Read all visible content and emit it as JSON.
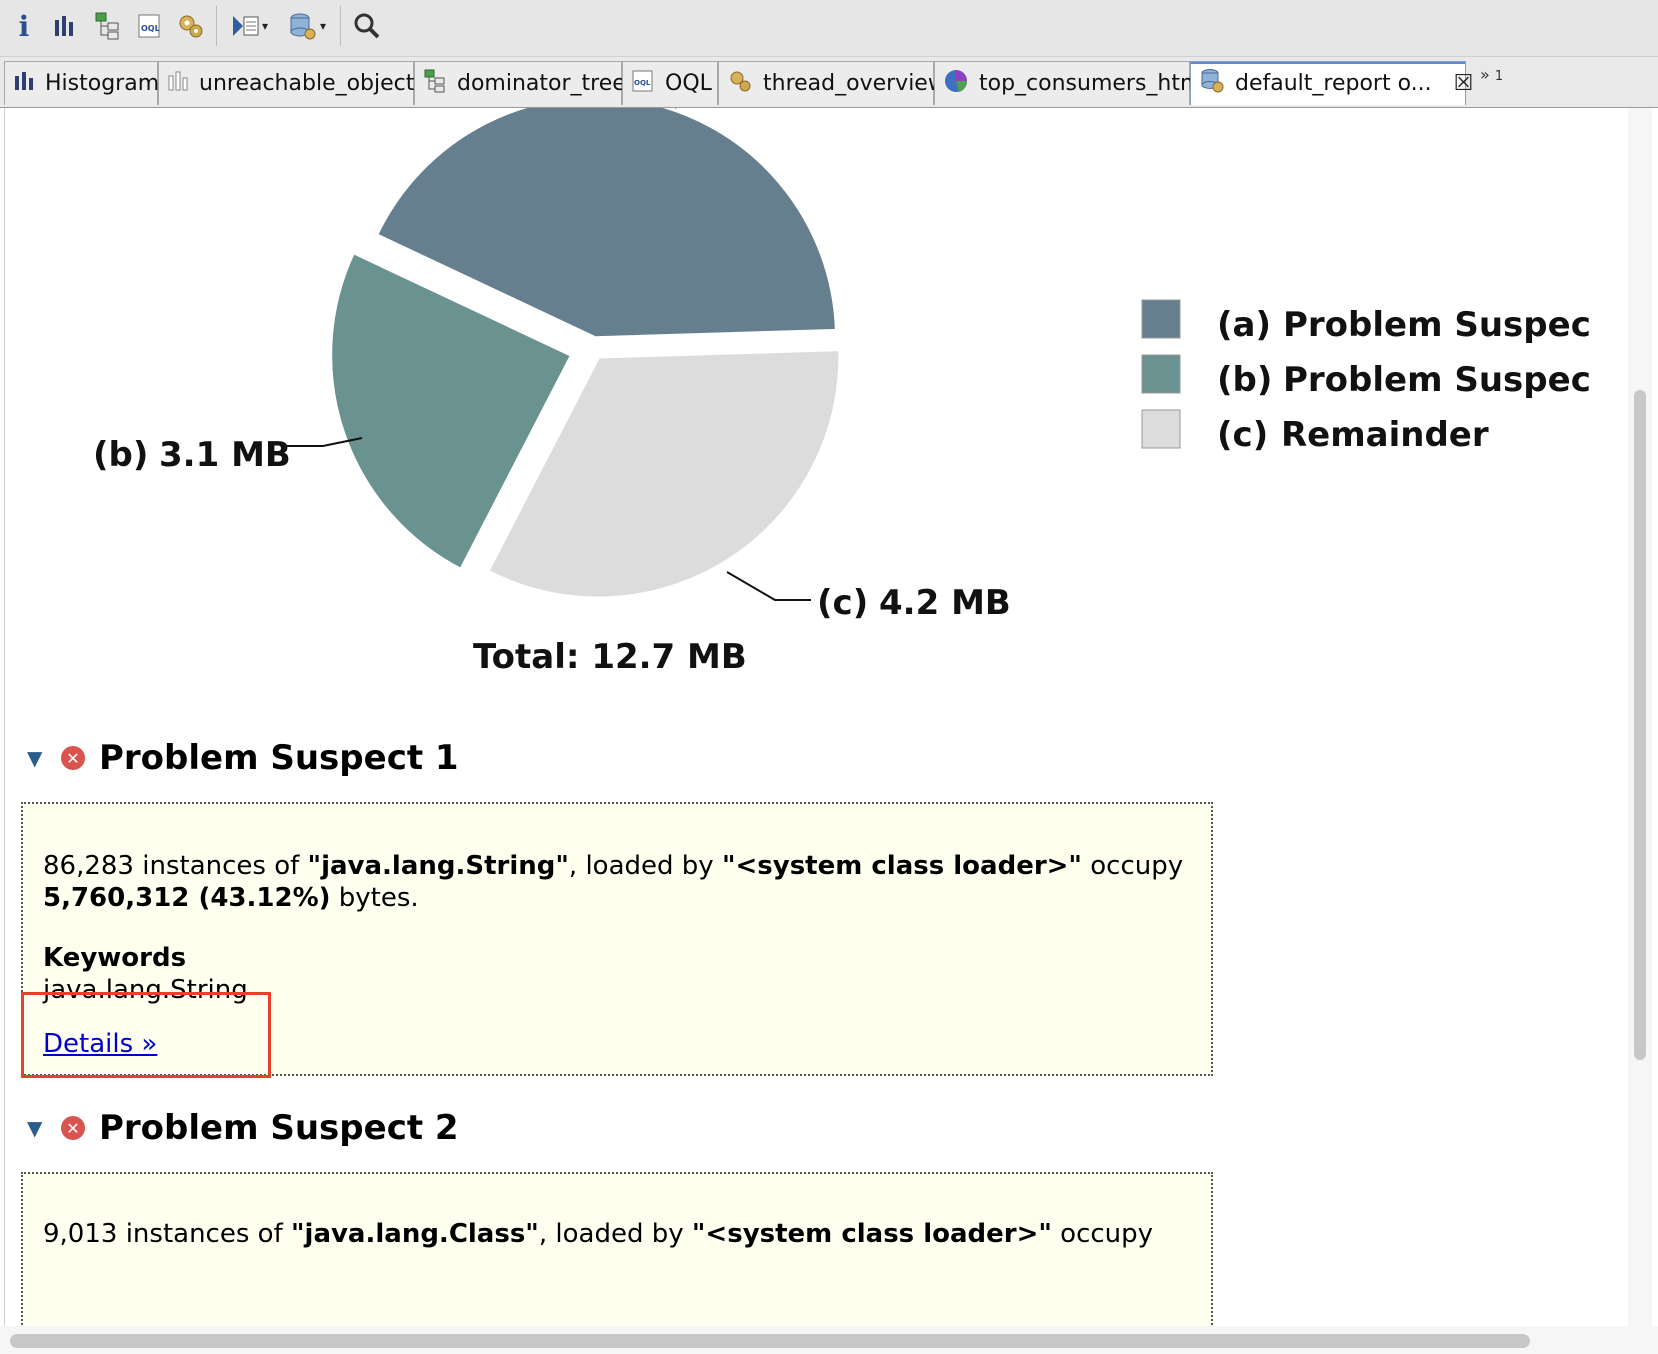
{
  "toolbar": {
    "icons": [
      "info-icon",
      "histogram-icon",
      "dominator-tree-icon",
      "oql-icon",
      "thread-overview-icon",
      "run-report-icon",
      "query-browser-icon",
      "search-icon"
    ]
  },
  "tabs": [
    {
      "label": "Histogram",
      "icon": "histogram-icon"
    },
    {
      "label": "unreachable_objects",
      "icon": "histogram-icon"
    },
    {
      "label": "dominator_tree",
      "icon": "dominator-tree-icon"
    },
    {
      "label": "OQL",
      "icon": "oql-icon"
    },
    {
      "label": "thread_overview",
      "icon": "thread-overview-icon"
    },
    {
      "label": "top_consumers_html",
      "icon": "pie-chart-icon"
    },
    {
      "label": "default_report  o...",
      "icon": "report-icon",
      "active": true
    }
  ],
  "overflow": {
    "chevron": "»",
    "count": "1"
  },
  "chart_data": {
    "type": "pie",
    "total_label": "Total: 12.7 MB",
    "slices": [
      {
        "id": "(a)",
        "legend": "Problem Suspec",
        "value_mb": 5.4,
        "color": "#667f8f"
      },
      {
        "id": "(b)",
        "legend": "Problem Suspec",
        "value_mb": 3.1,
        "label": "3.1 MB",
        "color": "#6a9290"
      },
      {
        "id": "(c)",
        "legend": "Remainder",
        "value_mb": 4.2,
        "label": "4.2 MB",
        "color": "#dcdcdc"
      }
    ]
  },
  "suspect1": {
    "title": "Problem Suspect 1",
    "count": "86,283",
    "t1": " instances of ",
    "cls": "\"java.lang.String\"",
    "t2": ", loaded by ",
    "loader": "\"<system class loader>\"",
    "t3": " occupy",
    "bytes": "5,760,312 (43.12%)",
    "t4": " bytes.",
    "keywords_label": "Keywords",
    "keywords": "java.lang.String",
    "details": "Details »"
  },
  "suspect2": {
    "title": "Problem Suspect 2",
    "count": "9,013",
    "t1": " instances of ",
    "cls": "\"java.lang.Class\"",
    "t2": ", loaded by ",
    "loader": "\"<system class loader>\"",
    "t3": " occupy"
  }
}
